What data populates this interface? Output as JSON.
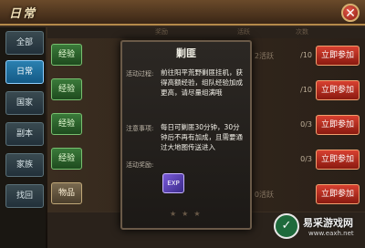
{
  "window": {
    "title": "日常"
  },
  "tabs": [
    {
      "label": "全部"
    },
    {
      "label": "日常",
      "active": true
    },
    {
      "label": "国家"
    },
    {
      "label": "副本"
    },
    {
      "label": "家族"
    },
    {
      "label": "找回"
    }
  ],
  "columns": [
    "奖励",
    "活跃",
    "次数"
  ],
  "rows": [
    {
      "badge": "经验",
      "vital": "2活跃",
      "progress": "/10",
      "button": "立即参加"
    },
    {
      "badge": "经验",
      "vital": "",
      "progress": "/10",
      "button": "立即参加"
    },
    {
      "badge": "经验",
      "vital": "",
      "progress": "0/3",
      "button": "立即参加"
    },
    {
      "badge": "经验",
      "vital": "",
      "progress": "0/3",
      "button": "立即参加"
    },
    {
      "badge": "物品",
      "vital": "0活跃",
      "progress": "",
      "button": "立即参加"
    }
  ],
  "dialog": {
    "title": "剿匪",
    "activity_label": "活动过程:",
    "activity_text": "前往阳平荒野剿匪挂机，获得高额经验，组队经验加成更高，请尽量组满哦",
    "notice_label": "注意事项:",
    "notice_text": "每日可剿匪30分钟，30分钟后不再有加成，且需要通过大地图传送进入",
    "reward_label": "活动奖励:",
    "reward_item": "EXP"
  },
  "watermark": {
    "name": "易采游戏网",
    "url": "www.eaxh.net"
  },
  "icons": {
    "close": "close-icon",
    "reward": "exp-scroll-icon",
    "logo": "watermark-logo-icon"
  }
}
